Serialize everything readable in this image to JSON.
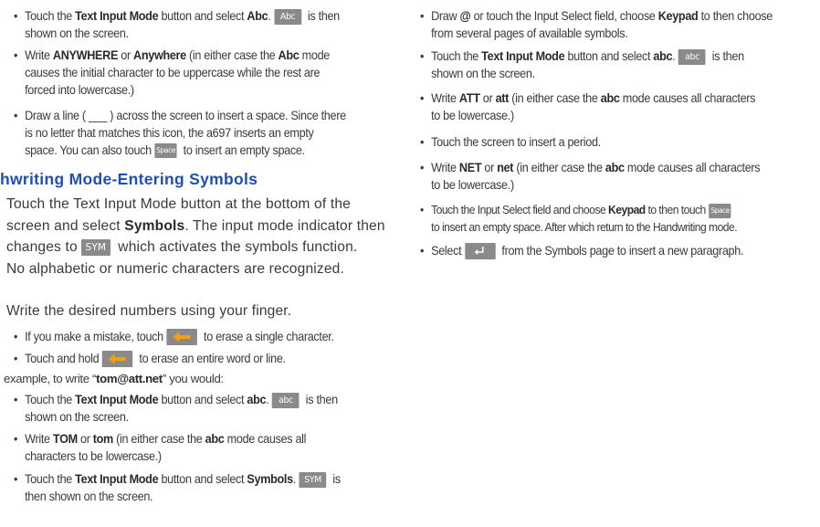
{
  "chips": {
    "abc_upper": "Abc",
    "abc_lower": "abc",
    "space": "Space",
    "sym": "SYM"
  },
  "left": {
    "b1": {
      "pre": "Touch the ",
      "bold1": "Text Input Mode",
      "mid": " button and select ",
      "bold2": "Abc",
      "post_dot": ".",
      "after_chip": " is then",
      "line2": "shown on the screen."
    },
    "b2": {
      "pre": "Write ",
      "bold1": "ANYWHERE",
      "mid1": " or ",
      "bold2": "Anywhere",
      "mid2": " (in either case the ",
      "bold3": "Abc",
      "post": " mode",
      "line2": "causes the initial character to be uppercase while the rest are",
      "line3": "forced into lowercase.)"
    },
    "b3": {
      "line1": "Draw a line ( ___ ) across the screen to insert a space. Since there",
      "line2": "is no letter that matches this icon, the a697 inserts an empty",
      "line3_pre": "space. You can also touch",
      "line3_post": " to insert an empty space."
    },
    "heading": "hwriting Mode-Entering Symbols",
    "p1": {
      "line1": "Touch the Text Input Mode button at the bottom of the",
      "line2_pre": "screen and select ",
      "line2_bold": "Symbols",
      "line2_post": ". The input mode indicator then",
      "line3_pre": "changes to",
      "line3_post": " which activates the symbols function.",
      "line4": "No alphabetic or numeric characters are recognized."
    },
    "p2": "Write the desired numbers using your finger.",
    "b4": {
      "pre": "If you make a mistake, touch",
      "post": " to erase a single character."
    },
    "b5": {
      "pre": "Touch and hold",
      "post": " to erase an entire word or line."
    },
    "p3": {
      "pre": "example, to write “",
      "bold": "tom@att.net",
      "post": "” you would:"
    },
    "b6": {
      "pre": "Touch the ",
      "bold1": "Text Input Mode",
      "mid": " button and select ",
      "bold2": "abc",
      "post_dot": ".",
      "after_chip": " is then",
      "line2": "shown on the screen."
    },
    "b7": {
      "pre": "Write ",
      "bold1": "TOM",
      "mid1": " or ",
      "bold2": "tom",
      "mid2": " (in either case the ",
      "bold3": "abc",
      "post": " mode causes all",
      "line2": "characters to be lowercase.)"
    },
    "b8": {
      "pre": "Touch the ",
      "bold1": "Text Input Mode",
      "mid": " button and select ",
      "bold2": "Symbols",
      "post_dot": ".",
      "after_chip": " is",
      "line2": "then shown on the screen."
    }
  },
  "right": {
    "r1": {
      "pre": "Draw ",
      "bold1": "@",
      "mid": " or touch the Input Select field, choose ",
      "bold2": "Keypad",
      "post": " to then choose",
      "line2": "from several pages of available symbols."
    },
    "r2": {
      "pre": "Touch the ",
      "bold1": "Text Input Mode",
      "mid": " button and select ",
      "bold2": "abc",
      "post_dot": ".",
      "after_chip": " is then",
      "line2": "shown on the screen."
    },
    "r3": {
      "pre": "Write ",
      "bold1": "ATT",
      "mid1": " or ",
      "bold2": "att",
      "mid2": " (in either case the ",
      "bold3": "abc",
      "post": " mode causes all characters",
      "line2": "to be lowercase.)"
    },
    "r4": "Touch the screen to insert a period.",
    "r5": {
      "pre": "Write ",
      "bold1": "NET",
      "mid1": " or ",
      "bold2": "net",
      "mid2": " (in either case the ",
      "bold3": "abc",
      "post": " mode causes all characters",
      "line2": "to be lowercase.)"
    },
    "r6": {
      "pre": "Touch the Input Select field and choose ",
      "bold": "Keypad",
      "post": " to then touch",
      "line2": "to insert an empty space. After which return to the Handwriting mode."
    },
    "r7": {
      "pre": "Select",
      "post": " from the Symbols page to insert a new paragraph."
    }
  },
  "colors": {
    "heading": "#1f4fb2",
    "chip": "#8a8a8a",
    "arrow": "#f2a20c"
  },
  "icons": [
    "backspace-arrow-icon",
    "enter-return-icon"
  ]
}
